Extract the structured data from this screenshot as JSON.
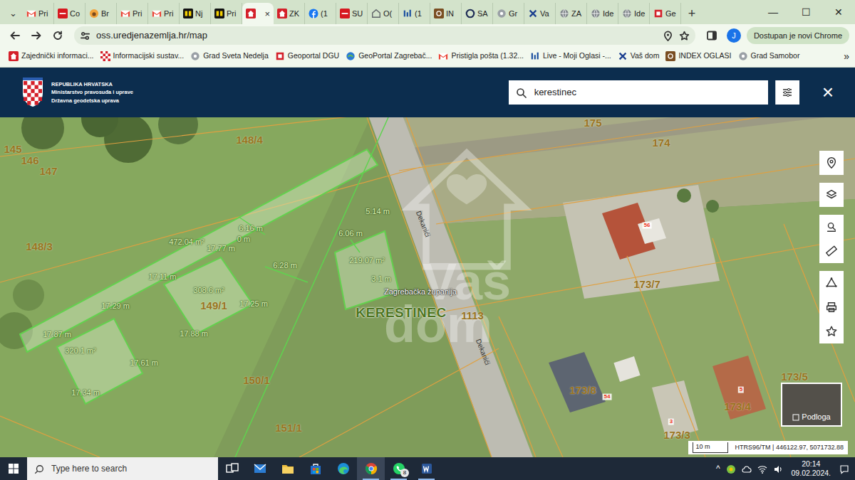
{
  "browser": {
    "tab_menu": "⌄",
    "tabs": [
      {
        "label": "Pri",
        "kind": "gmail",
        "selected": false
      },
      {
        "label": "Co",
        "kind": "vic",
        "selected": false
      },
      {
        "label": "Br",
        "kind": "bear",
        "selected": false
      },
      {
        "label": "Pri",
        "kind": "gmail",
        "selected": false
      },
      {
        "label": "Pri",
        "kind": "gmail",
        "selected": false
      },
      {
        "label": "Nj",
        "kind": "nj",
        "selected": false
      },
      {
        "label": "Pri",
        "kind": "nj",
        "selected": false
      },
      {
        "close": "×",
        "kind": "house",
        "selected": true
      },
      {
        "label": "ZK",
        "kind": "house",
        "selected": false
      },
      {
        "label": "(1",
        "kind": "facebook",
        "selected": false
      },
      {
        "label": "SU",
        "kind": "vic",
        "selected": false
      },
      {
        "label": "O(",
        "kind": "home",
        "selected": false
      },
      {
        "label": "(1",
        "kind": "bars",
        "selected": false
      },
      {
        "label": "IN",
        "kind": "xo",
        "selected": false
      },
      {
        "label": "SA",
        "kind": "ring",
        "selected": false
      },
      {
        "label": "Gr",
        "kind": "gear",
        "selected": false
      },
      {
        "label": "Va",
        "kind": "x",
        "selected": false
      },
      {
        "label": "ZA",
        "kind": "globe",
        "selected": false
      },
      {
        "label": "Ide",
        "kind": "globe",
        "selected": false
      },
      {
        "label": "Ide",
        "kind": "globe",
        "selected": false
      },
      {
        "label": "Ge",
        "kind": "flag",
        "selected": false
      }
    ],
    "new_tab": "+",
    "window_controls": [
      "—",
      "☐",
      "✕"
    ],
    "url": "oss.uredjenazemlja.hr/map",
    "profile": "J",
    "update_button": "Dostupan je novi Chrome",
    "bookmarks": [
      {
        "label": "Zajednički informaci...",
        "kind": "house"
      },
      {
        "label": "Informacijski sustav...",
        "kind": "checker"
      },
      {
        "label": "Grad Sveta Nedelja",
        "kind": "gear"
      },
      {
        "label": "Geoportal DGU",
        "kind": "flag"
      },
      {
        "label": "GeoPortal Zagrebač...",
        "kind": "geo"
      },
      {
        "label": "Pristigla pošta (1.32...",
        "kind": "gmail"
      },
      {
        "label": "Live - Moji Oglasi -...",
        "kind": "bars"
      },
      {
        "label": "Vaš dom",
        "kind": "x"
      },
      {
        "label": "INDEX OGLASI",
        "kind": "xo"
      },
      {
        "label": "Grad Samobor",
        "kind": "gear"
      }
    ],
    "bookmarks_more": "»"
  },
  "app": {
    "org": [
      "REPUBLIKA HRVATSKA",
      "Ministarstvo pravosuđa i uprave",
      "Državna geodetska uprava"
    ],
    "search": {
      "value": "kerestinec"
    },
    "close": "×"
  },
  "map": {
    "parcels": [
      "145",
      "146",
      "147",
      "148/4",
      "148/3",
      "149/1",
      "150/1",
      "151/1",
      "175",
      "174",
      "173/7",
      "173/8",
      "173/4",
      "173/5",
      "173/3",
      "1113"
    ],
    "house_numbers": [
      "56",
      "54",
      "5",
      "3"
    ],
    "streets": [
      "Dekanići",
      "Dekanići"
    ],
    "region": "Zagrebačka županija",
    "place": "KERESTINEC",
    "measurements": [
      "472.04 m²",
      "6.16 m",
      "17.77 m",
      "0 m",
      "5.14 m",
      "6.06 m",
      "219.07 m²",
      "3.1 m",
      "6.28 m",
      "17.11 m",
      "308.6 m²",
      "17.29 m",
      "17.25 m",
      "17.87 m",
      "17.88 m",
      "320.1 m²",
      "17.61 m",
      "17.34 m"
    ],
    "watermark": [
      "Vaš",
      "dom"
    ],
    "basemap_button": "Podloga",
    "scale": "10 m",
    "coordinates": "HTRS96/TM | 446122.97, 5071732.88"
  },
  "taskbar": {
    "search_placeholder": "Type here to search",
    "apps": [
      {
        "kind": "taskview",
        "running": false,
        "selected": false
      },
      {
        "kind": "mail",
        "running": false,
        "selected": false
      },
      {
        "kind": "explorer",
        "running": false,
        "selected": false
      },
      {
        "kind": "store",
        "running": false,
        "selected": false
      },
      {
        "kind": "edge",
        "running": false,
        "selected": false
      },
      {
        "kind": "chrome",
        "running": true,
        "selected": true
      },
      {
        "kind": "whatsapp",
        "running": true,
        "selected": false,
        "badge": "8"
      },
      {
        "kind": "word",
        "running": true,
        "selected": false
      }
    ],
    "tray_chevron": "^",
    "time": "20:14",
    "date": "09.02.2024."
  }
}
